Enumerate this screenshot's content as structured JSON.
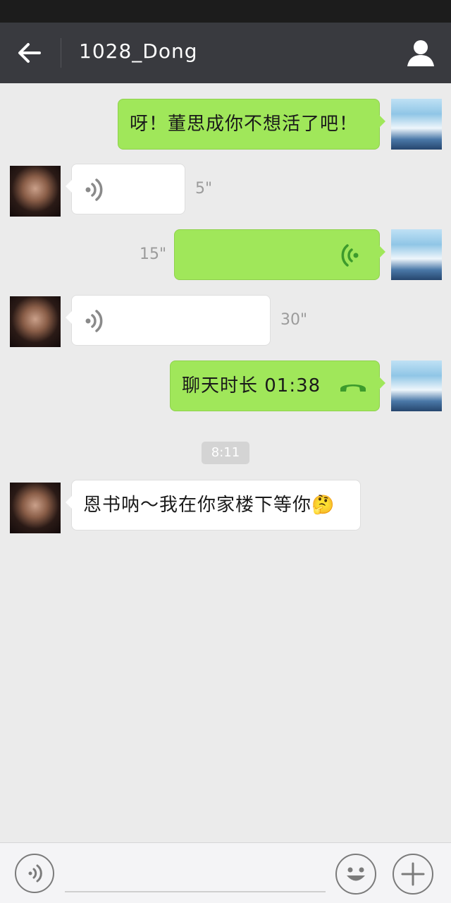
{
  "header": {
    "title": "1028_Dong"
  },
  "messages": {
    "m1_text": "呀！董思成你不想活了吧！",
    "m2_duration": "5\"",
    "m3_duration": "15\"",
    "m4_duration": "30\"",
    "m5_call_label": "聊天时长 01:38",
    "timestamp": "8:11",
    "m6_text": "恩书呐～我在你家楼下等你🤔"
  },
  "colors": {
    "header_bg": "#393a3f",
    "sent_bubble": "#a0e75a",
    "received_bubble": "#ffffff",
    "chat_bg": "#ebebeb"
  },
  "icons": [
    "back-arrow-icon",
    "profile-icon",
    "voice-wave-icon",
    "phone-hangup-icon",
    "voice-input-icon",
    "emoji-icon",
    "plus-icon"
  ]
}
